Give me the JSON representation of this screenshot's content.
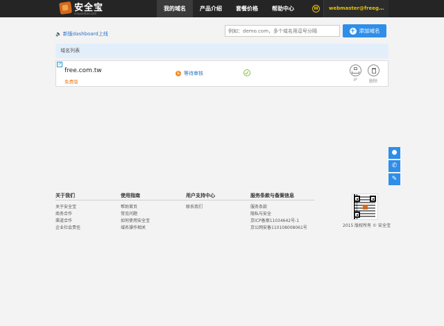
{
  "brand": {
    "name": "安全宝",
    "sub": "anquanbao.com"
  },
  "nav": {
    "items": [
      {
        "label": "我的域名",
        "active": true
      },
      {
        "label": "产品介绍",
        "active": false
      },
      {
        "label": "套餐价格",
        "active": false
      },
      {
        "label": "帮助中心",
        "active": false
      }
    ],
    "user_email": "webmaster@freeg...",
    "user_icon": "W"
  },
  "notice": {
    "text": "新版dashboard上线"
  },
  "search": {
    "placeholder": "例如：demo.com，多个域名用逗号分隔",
    "value": ""
  },
  "add_domain": {
    "label": "添加域名"
  },
  "domain_list": {
    "header": "域名列表",
    "rows": [
      {
        "domain": "free.com.tw",
        "plan": "免费版",
        "status": "等待审核",
        "actions": {
          "ip_label": "IP",
          "delete_label": "删除"
        }
      }
    ]
  },
  "footer": {
    "columns": [
      {
        "title": "关于我们",
        "links": [
          "关于安全宝",
          "商务合作",
          "渠道合作",
          "企业社会责任"
        ]
      },
      {
        "title": "使用指南",
        "links": [
          "帮助首页",
          "常见问题",
          "如何使用安全宝",
          "域名操作相关"
        ]
      },
      {
        "title": "用户支持中心",
        "links": [
          "联系我们"
        ]
      },
      {
        "title": "服务条款与备案信息",
        "links": [
          "服务条款",
          "隐私与安全",
          "京ICP备案11034642号-1",
          "京公网安备110108008061号"
        ]
      }
    ],
    "copyright": "2015 版权所有 © 安全宝"
  },
  "colors": {
    "nav_bg": "#252525",
    "accent_blue": "#2f8ee8",
    "plan_orange": "#ef7d1c",
    "user_yellow": "#e8c200"
  }
}
